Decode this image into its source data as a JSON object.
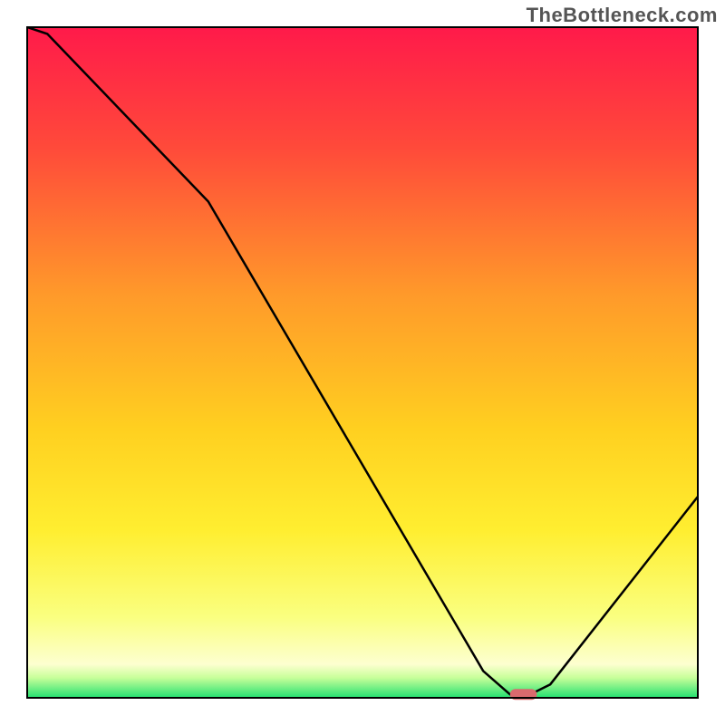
{
  "watermark": "TheBottleneck.com",
  "chart_data": {
    "type": "line",
    "title": "",
    "xlabel": "",
    "ylabel": "",
    "xlim": [
      0,
      100
    ],
    "ylim": [
      0,
      100
    ],
    "x": [
      0,
      3,
      27,
      68,
      72,
      75,
      78,
      100
    ],
    "values": [
      100,
      99,
      74,
      4,
      0.5,
      0.5,
      2,
      30
    ],
    "marker": {
      "x_start": 72,
      "x_end": 76,
      "y": 0.5,
      "color": "#d96a6e"
    },
    "gradient_stops": [
      {
        "offset": 0,
        "color": "#ff1a4a"
      },
      {
        "offset": 18,
        "color": "#ff4a3a"
      },
      {
        "offset": 40,
        "color": "#ff9a2a"
      },
      {
        "offset": 60,
        "color": "#ffd020"
      },
      {
        "offset": 75,
        "color": "#ffee30"
      },
      {
        "offset": 88,
        "color": "#faff80"
      },
      {
        "offset": 95,
        "color": "#fdffd0"
      },
      {
        "offset": 97,
        "color": "#c8ff9a"
      },
      {
        "offset": 100,
        "color": "#22e070"
      }
    ]
  },
  "plot": {
    "inner_x": 30,
    "inner_y": 30,
    "inner_w": 740,
    "inner_h": 740
  }
}
